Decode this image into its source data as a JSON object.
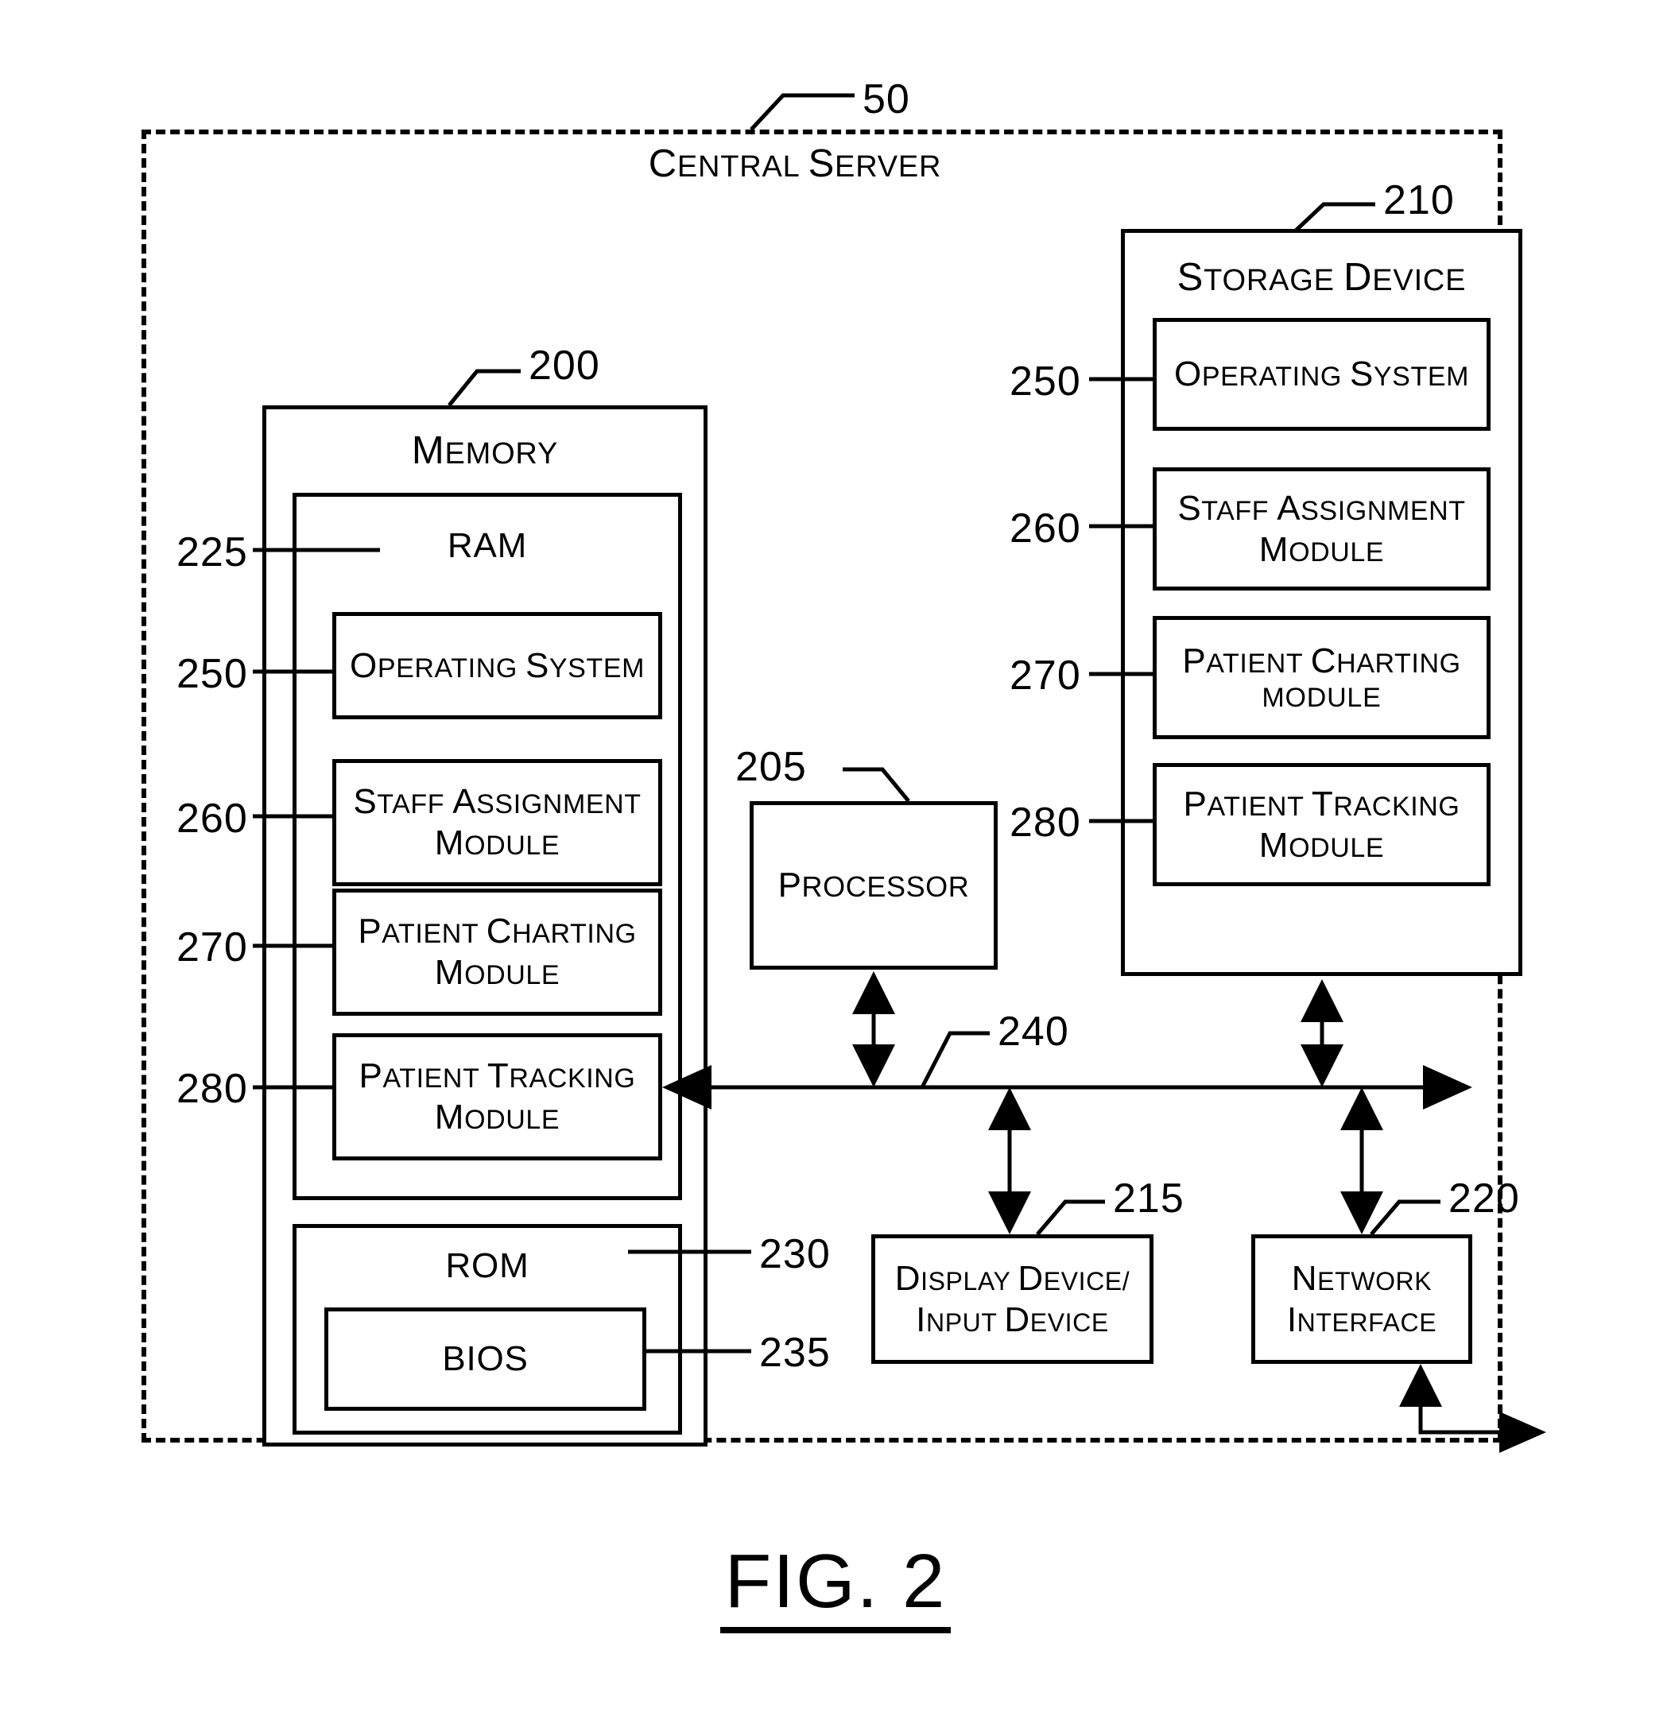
{
  "figure": {
    "caption": "FIG. 2",
    "enclosure": {
      "label": "Central Server",
      "ref": "50"
    }
  },
  "memory": {
    "title": "Memory",
    "ref": "200",
    "ram": {
      "title": "RAM",
      "ref": "225",
      "modules": [
        {
          "ref": "250",
          "line1": "Operating System",
          "line2": ""
        },
        {
          "ref": "260",
          "line1": "Staff Assignment",
          "line2": "Module"
        },
        {
          "ref": "270",
          "line1": "Patient Charting",
          "line2": "Module"
        },
        {
          "ref": "280",
          "line1": "Patient Tracking",
          "line2": "Module"
        }
      ]
    },
    "rom": {
      "title": "ROM",
      "ref": "230",
      "bios": {
        "title": "BIOS",
        "ref": "235"
      }
    }
  },
  "processor": {
    "title": "Processor",
    "ref": "205"
  },
  "storage_device": {
    "title": "Storage Device",
    "ref": "210",
    "modules": [
      {
        "ref": "250",
        "line1": "Operating System",
        "line2": ""
      },
      {
        "ref": "260",
        "line1": "Staff Assignment",
        "line2": "Module"
      },
      {
        "ref": "270",
        "line1": "Patient Charting",
        "line2": "module"
      },
      {
        "ref": "280",
        "line1": "Patient Tracking",
        "line2": "Module"
      }
    ]
  },
  "bus": {
    "ref": "240"
  },
  "display_device": {
    "line1": "Display device/",
    "line2": "Input device",
    "ref": "215"
  },
  "network_interface": {
    "line1": "Network",
    "line2": "Interface",
    "ref": "220"
  },
  "colors": {
    "ink": "#000000",
    "paper": "#ffffff"
  }
}
